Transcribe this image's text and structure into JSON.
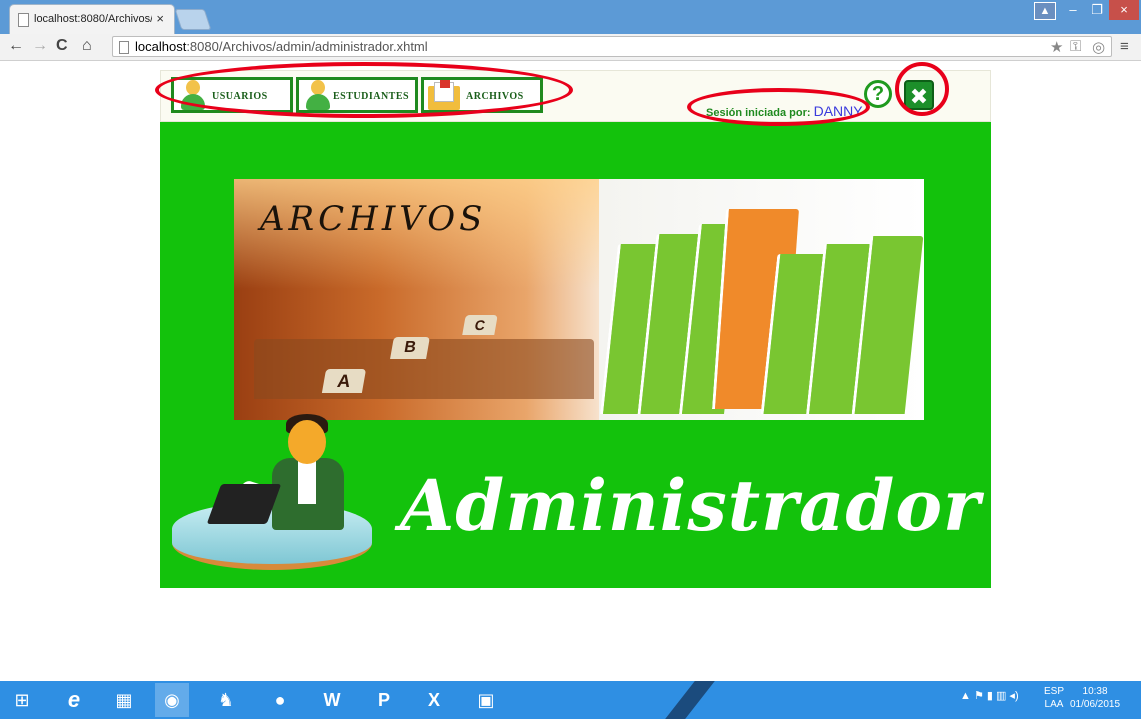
{
  "browser": {
    "tab_title": "localhost:8080/Archivos/a",
    "tab_close": "×",
    "url_host": "localhost",
    "url_path": ":8080/Archivos/admin/administrador.xhtml",
    "window_user": "▲",
    "window_min": "–",
    "window_max": "❐",
    "window_close": "×"
  },
  "nav": {
    "usuarios": "USUARIOS",
    "estudiantes": "ESTUDIANTES",
    "archivos": "ARCHIVOS"
  },
  "session": {
    "label": "Sesión iniciada por:",
    "user": "DANNY",
    "help": "?",
    "exit": "✖"
  },
  "hero": {
    "archivos_word": "ARCHIVOS",
    "tab_a": "A",
    "tab_b": "B",
    "tab_c": "C"
  },
  "banner": {
    "title": "Administrador"
  },
  "taskbar": {
    "lang_top": "ESP",
    "lang_bottom": "LAA",
    "time": "10:38",
    "date": "01/06/2015",
    "tray": "▲  ⚑  ▮  ▥  ◂)"
  },
  "colors": {
    "banner_green": "#13c20c",
    "nav_border": "#1f8a1f",
    "annotation_red": "#e8001a"
  }
}
